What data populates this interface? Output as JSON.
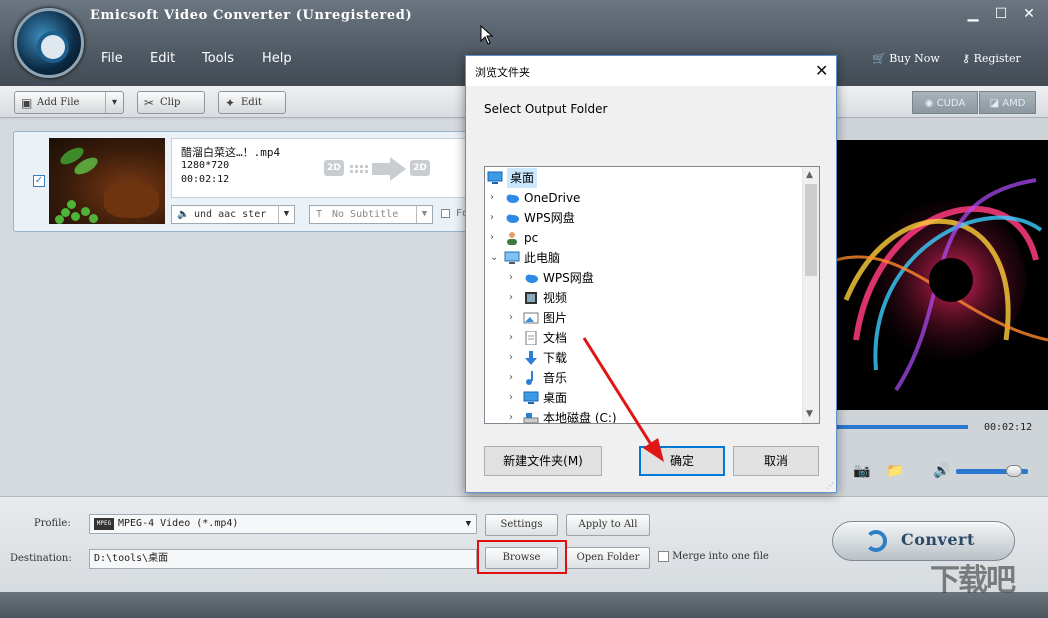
{
  "app": {
    "title": "Emicsoft Video Converter (Unregistered)",
    "menu": [
      "File",
      "Edit",
      "Tools",
      "Help"
    ],
    "buy_now": "Buy Now",
    "register": "Register"
  },
  "toolbar": {
    "add_file": "Add File",
    "clip": "Clip",
    "edit": "Edit",
    "cuda": "CUDA",
    "amd": "AMD"
  },
  "file_item": {
    "name": "醋溜白菜这…！.mp4",
    "resolution": "1280*720",
    "duration": "00:02:12",
    "badge_in": "2D",
    "badge_out": "2D",
    "audio": "und aac ster",
    "subtitle": "No Subtitle",
    "forced": "Fo"
  },
  "preview": {
    "time": "00:02:12",
    "volume": 0.8
  },
  "bottom": {
    "profile_label": "Profile:",
    "profile_value": "MPEG-4 Video (*.mp4)",
    "settings": "Settings",
    "apply_to_all": "Apply to All",
    "destination_label": "Destination:",
    "destination_value": "D:\\tools\\桌面",
    "browse": "Browse",
    "open_folder": "Open Folder",
    "merge": "Merge into one file",
    "convert": "Convert"
  },
  "dialog": {
    "title": "浏览文件夹",
    "prompt": "Select Output Folder",
    "tree": [
      {
        "label": "桌面",
        "icon": "desktop-icon",
        "level": 0,
        "expander": "",
        "selected": true
      },
      {
        "label": "OneDrive",
        "icon": "cloud-icon",
        "level": 1,
        "expander": "›"
      },
      {
        "label": "WPS网盘",
        "icon": "cloud-icon",
        "level": 1,
        "expander": "›"
      },
      {
        "label": "pc",
        "icon": "user-icon",
        "level": 1,
        "expander": "›"
      },
      {
        "label": "此电脑",
        "icon": "computer-icon",
        "level": 1,
        "expander": "⌄"
      },
      {
        "label": "WPS网盘",
        "icon": "cloud-icon",
        "level": 2,
        "expander": "›"
      },
      {
        "label": "视频",
        "icon": "video-folder-icon",
        "level": 2,
        "expander": "›"
      },
      {
        "label": "图片",
        "icon": "picture-folder-icon",
        "level": 2,
        "expander": "›"
      },
      {
        "label": "文档",
        "icon": "document-folder-icon",
        "level": 2,
        "expander": "›"
      },
      {
        "label": "下载",
        "icon": "download-folder-icon",
        "level": 2,
        "expander": "›"
      },
      {
        "label": "音乐",
        "icon": "music-folder-icon",
        "level": 2,
        "expander": "›"
      },
      {
        "label": "桌面",
        "icon": "desktop-icon",
        "level": 2,
        "expander": "›"
      },
      {
        "label": "本地磁盘 (C:)",
        "icon": "drive-icon",
        "level": 2,
        "expander": "›"
      }
    ],
    "new_folder": "新建文件夹(M)",
    "ok": "确定",
    "cancel": "取消"
  },
  "watermark": "下载吧"
}
